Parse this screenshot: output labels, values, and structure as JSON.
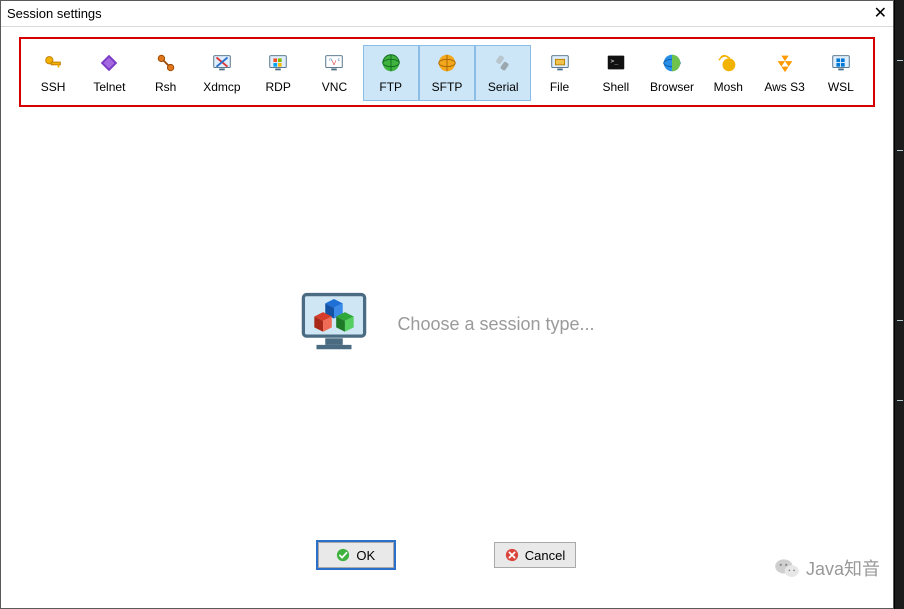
{
  "window": {
    "title": "Session settings",
    "close_glyph": "✕"
  },
  "session_types": [
    {
      "id": "ssh",
      "label": "SSH",
      "selected": false
    },
    {
      "id": "telnet",
      "label": "Telnet",
      "selected": false
    },
    {
      "id": "rsh",
      "label": "Rsh",
      "selected": false
    },
    {
      "id": "xdmcp",
      "label": "Xdmcp",
      "selected": false
    },
    {
      "id": "rdp",
      "label": "RDP",
      "selected": false
    },
    {
      "id": "vnc",
      "label": "VNC",
      "selected": false
    },
    {
      "id": "ftp",
      "label": "FTP",
      "selected": true
    },
    {
      "id": "sftp",
      "label": "SFTP",
      "selected": true
    },
    {
      "id": "serial",
      "label": "Serial",
      "selected": true
    },
    {
      "id": "file",
      "label": "File",
      "selected": false
    },
    {
      "id": "shell",
      "label": "Shell",
      "selected": false
    },
    {
      "id": "browser",
      "label": "Browser",
      "selected": false
    },
    {
      "id": "mosh",
      "label": "Mosh",
      "selected": false
    },
    {
      "id": "awss3",
      "label": "Aws S3",
      "selected": false
    },
    {
      "id": "wsl",
      "label": "WSL",
      "selected": false
    }
  ],
  "center": {
    "prompt": "Choose a session type..."
  },
  "buttons": {
    "ok": "OK",
    "cancel": "Cancel"
  },
  "watermark": {
    "text": "Java知音"
  },
  "colors": {
    "highlight_border": "#d40000",
    "selected_bg": "#cce6f7"
  }
}
